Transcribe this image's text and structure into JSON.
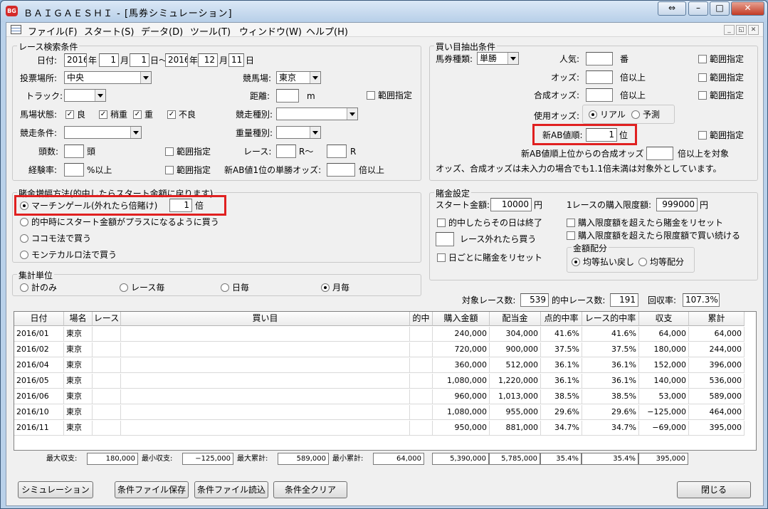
{
  "window": {
    "title": "ＢＡＩＧＡＥＳＨＩ - [馬券シミュレーション]",
    "icon_text": "BG"
  },
  "menu": [
    "ファイル(F)",
    "スタート(S)",
    "データ(D)",
    "ツール(T)",
    "ウィンドウ(W)",
    "ヘルプ(H)"
  ],
  "race_cond": {
    "title": "レース検索条件",
    "date_label": "日付:",
    "year_from": "2016",
    "year_suffix": "年",
    "month_from": "1",
    "month_suffix": "月",
    "day_from": "1",
    "day_suffix_range": "日～",
    "year_to": "2016",
    "month_to": "12",
    "day_to": "11",
    "day_suffix": "日",
    "venue_label": "投票場所:",
    "venue_value": "中央",
    "course_label": "競馬場:",
    "course_value": "東京",
    "track_label": "トラック:",
    "track_value": "",
    "distance_label": "距離:",
    "distance_value": "",
    "distance_unit": "m",
    "range_label": "範囲指定",
    "condition_label": "馬場状態:",
    "cond1": "良",
    "cond2": "稍重",
    "cond3": "重",
    "cond4": "不良",
    "racetype_label": "競走種別:",
    "racecond_label": "競走条件:",
    "weight_label": "重量種別:",
    "heads_label": "頭数:",
    "heads_unit": "頭",
    "race_label": "レース:",
    "race_from_unit": "R～",
    "race_to_unit": "R",
    "exp_label": "経験率:",
    "exp_unit": "%以上",
    "ab_win_label": "新AB値1位の単勝オッズ:",
    "ab_win_unit": "倍以上"
  },
  "bet_cond": {
    "title": "買い目抽出条件",
    "kind_label": "馬券種類:",
    "kind_value": "単勝",
    "pop_label": "人気:",
    "pop_unit": "番",
    "odds_label": "オッズ:",
    "odds_unit": "倍以上",
    "comp_label": "合成オッズ:",
    "comp_unit": "倍以上",
    "range_label": "範囲指定",
    "use_odds_label": "使用オッズ:",
    "use_real": "リアル",
    "use_pred": "予測",
    "ab_rank_label": "新AB値順:",
    "ab_rank_value": "1",
    "ab_rank_unit": "位",
    "ab_top_label": "新AB値順上位からの合成オッズ",
    "ab_top_unit": "倍以上を対象",
    "note": "オッズ、合成オッズは未入力の場合でも1.1倍未満は対象外としています。"
  },
  "increase": {
    "title": "賭金増幅方法(的中したらスタート金額に戻ります)",
    "opt1": "マーチンゲール(外れたら倍賭け)",
    "opt1_value": "1",
    "opt1_unit": "倍",
    "opt2": "的中時にスタート金額がプラスになるように買う",
    "opt3": "ココモ法で買う",
    "opt4": "モンテカルロ法で買う"
  },
  "bet_setting": {
    "title": "賭金設定",
    "start_label": "スタート金額:",
    "start_value": "10000",
    "yen": "円",
    "limit_label": "1レースの購入限度額:",
    "limit_value": "999000",
    "chk1": "的中したらその日は終了",
    "chk2": "レース外れたら買う",
    "chk3": "日ごとに賭金をリセット",
    "chk4": "購入限度額を超えたら賭金をリセット",
    "chk5": "購入限度額を超えたら限度額で買い続ける",
    "dist_title": "金額配分",
    "dist1": "均等払い戻し",
    "dist2": "均等配分"
  },
  "unit": {
    "title": "集計単位",
    "opt1": "計のみ",
    "opt2": "レース毎",
    "opt3": "日毎",
    "opt4": "月毎"
  },
  "summary": {
    "races_label": "対象レース数:",
    "races": "539",
    "hits_label": "的中レース数:",
    "hits": "191",
    "rate_label": "回収率:",
    "rate": "107.3%"
  },
  "table": {
    "headers": [
      "日付",
      "場名",
      "レース",
      "買い目",
      "的中",
      "購入金額",
      "配当金",
      "点的中率",
      "レース的中率",
      "収支",
      "累計"
    ],
    "rows": [
      [
        "2016/01",
        "東京",
        "",
        "",
        "",
        "240,000",
        "304,000",
        "41.6%",
        "41.6%",
        "64,000",
        "64,000"
      ],
      [
        "2016/02",
        "東京",
        "",
        "",
        "",
        "720,000",
        "900,000",
        "37.5%",
        "37.5%",
        "180,000",
        "244,000"
      ],
      [
        "2016/04",
        "東京",
        "",
        "",
        "",
        "360,000",
        "512,000",
        "36.1%",
        "36.1%",
        "152,000",
        "396,000"
      ],
      [
        "2016/05",
        "東京",
        "",
        "",
        "",
        "1,080,000",
        "1,220,000",
        "36.1%",
        "36.1%",
        "140,000",
        "536,000"
      ],
      [
        "2016/06",
        "東京",
        "",
        "",
        "",
        "960,000",
        "1,013,000",
        "38.5%",
        "38.5%",
        "53,000",
        "589,000"
      ],
      [
        "2016/10",
        "東京",
        "",
        "",
        "",
        "1,080,000",
        "955,000",
        "29.6%",
        "29.6%",
        "−125,000",
        "464,000"
      ],
      [
        "2016/11",
        "東京",
        "",
        "",
        "",
        "950,000",
        "881,000",
        "34.7%",
        "34.7%",
        "−69,000",
        "395,000"
      ]
    ]
  },
  "totals": {
    "max_label": "最大収支:",
    "max": "180,000",
    "min_label": "最小収支:",
    "min": "−125,000",
    "maxc_label": "最大累計:",
    "maxc": "589,000",
    "minc_label": "最小累計:",
    "minc": "64,000",
    "buy": "5,390,000",
    "pay": "5,785,000",
    "hit": "35.4%",
    "rhit": "35.4%",
    "cum": "395,000"
  },
  "buttons": {
    "simulate": "シミュレーション",
    "save": "条件ファイル保存",
    "load": "条件ファイル読込",
    "clear": "条件全クリア",
    "close": "閉じる"
  }
}
